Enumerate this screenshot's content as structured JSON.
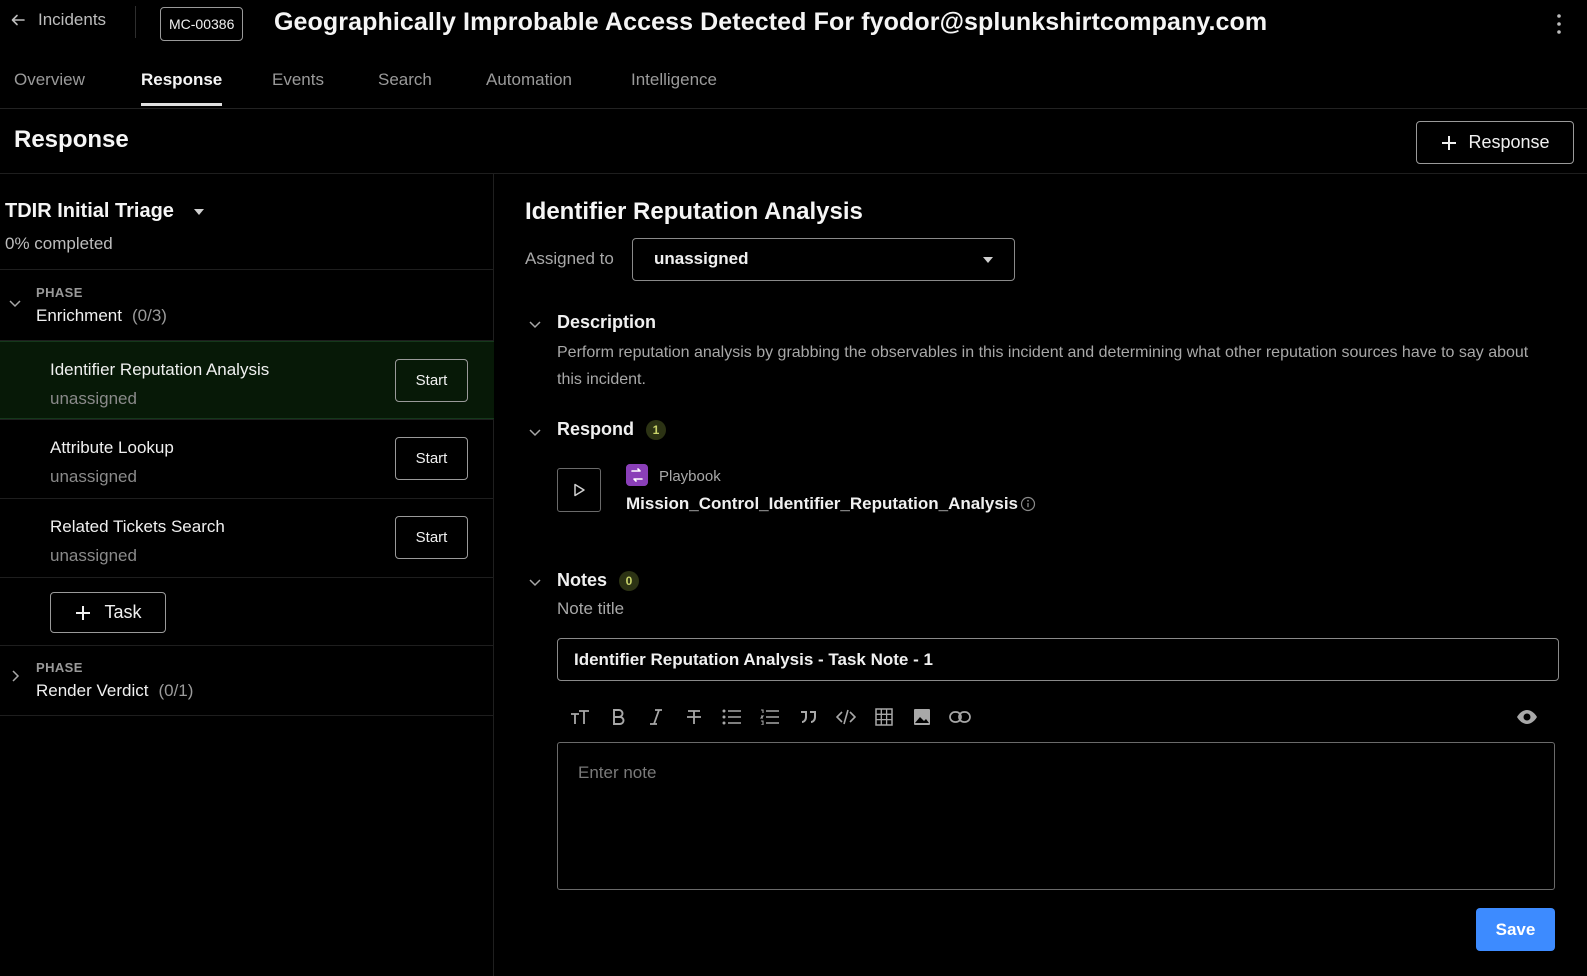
{
  "header": {
    "back_label": "Incidents",
    "incident_id": "MC-00386",
    "title": "Geographically Improbable Access Detected For fyodor@splunkshirtcompany.com"
  },
  "tabs": [
    {
      "label": "Overview",
      "active": false
    },
    {
      "label": "Response",
      "active": true
    },
    {
      "label": "Events",
      "active": false
    },
    {
      "label": "Search",
      "active": false
    },
    {
      "label": "Automation",
      "active": false
    },
    {
      "label": "Intelligence",
      "active": false
    }
  ],
  "page": {
    "title": "Response",
    "add_response_label": "Response"
  },
  "workbook": {
    "name": "TDIR Initial Triage",
    "progress_text": "0% completed",
    "phases": [
      {
        "label": "PHASE",
        "name": "Enrichment",
        "count": "(0/3)",
        "expanded": true,
        "tasks": [
          {
            "name": "Identifier Reputation Analysis",
            "assignee": "unassigned",
            "action": "Start",
            "selected": true
          },
          {
            "name": "Attribute Lookup",
            "assignee": "unassigned",
            "action": "Start",
            "selected": false
          },
          {
            "name": "Related Tickets Search",
            "assignee": "unassigned",
            "action": "Start",
            "selected": false
          }
        ],
        "add_task_label": "Task"
      },
      {
        "label": "PHASE",
        "name": "Render Verdict",
        "count": "(0/1)",
        "expanded": false
      }
    ]
  },
  "detail": {
    "title": "Identifier Reputation Analysis",
    "assigned_label": "Assigned to",
    "assigned_value": "unassigned",
    "description": {
      "title": "Description",
      "text": "Perform reputation analysis by grabbing the observables in this incident and determining what other reputation sources have to say about this incident."
    },
    "respond": {
      "title": "Respond",
      "count": "1",
      "playbook_type": "Playbook",
      "playbook_name": "Mission_Control_Identifier_Reputation_Analysis"
    },
    "notes": {
      "title": "Notes",
      "count": "0",
      "note_title_label": "Note title",
      "note_title_value": "Identifier Reputation Analysis - Task Note - 1",
      "note_placeholder": "Enter note",
      "save_label": "Save",
      "toolbar_icons": [
        "text-size-icon",
        "bold-icon",
        "italic-icon",
        "strikethrough-icon",
        "bulleted-list-icon",
        "numbered-list-icon",
        "quote-icon",
        "code-icon",
        "table-icon",
        "image-icon",
        "link-icon",
        "preview-eye-icon"
      ]
    }
  },
  "colors": {
    "background": "#000000",
    "selected_task_bg": "#071907",
    "primary_button": "#3d8bff",
    "badge_bg": "#2c3314",
    "badge_text": "#c9d46a",
    "playbook_icon": "#8a3fb8"
  }
}
